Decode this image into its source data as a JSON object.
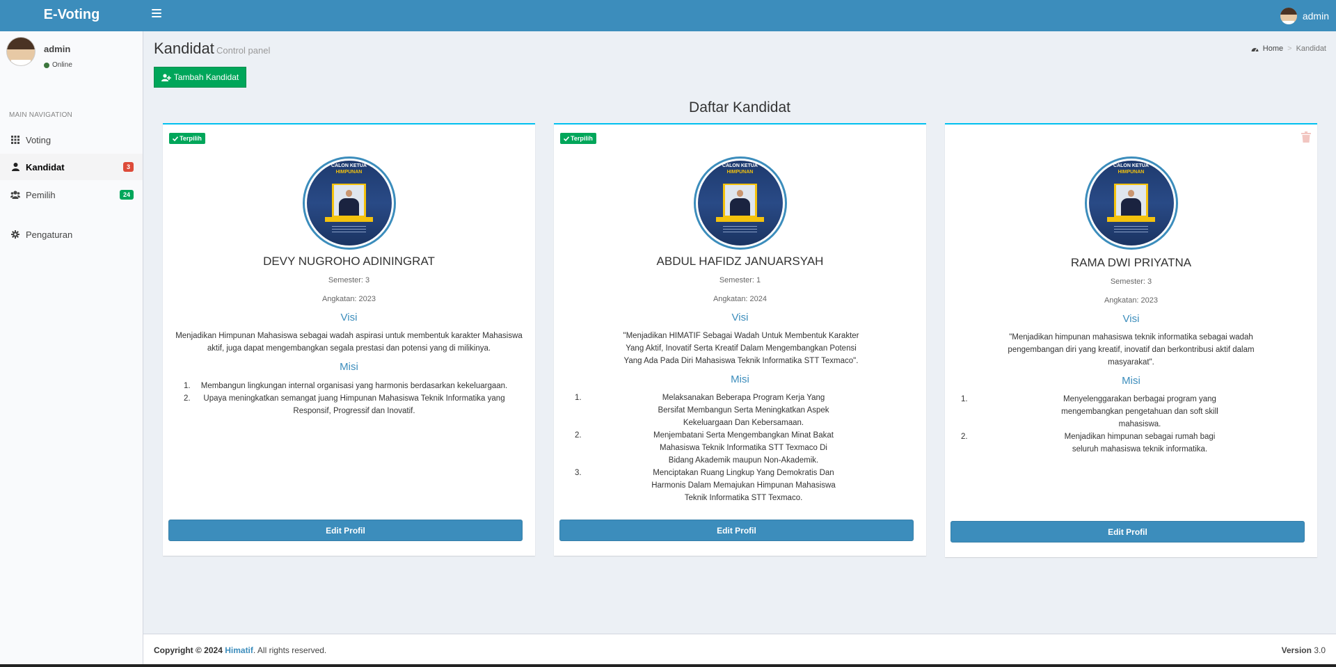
{
  "app": {
    "title": "E-Voting",
    "user": "admin"
  },
  "sidebar": {
    "user_name": "admin",
    "status": "Online",
    "header": "MAIN NAVIGATION",
    "items": [
      {
        "label": "Voting",
        "icon": "grid-icon"
      },
      {
        "label": "Kandidat",
        "icon": "user-icon",
        "badge": "3",
        "badge_color": "#dd4b39",
        "active": true
      },
      {
        "label": "Pemilih",
        "icon": "users-icon",
        "badge": "24",
        "badge_color": "#00a65a"
      },
      {
        "label": "Pengaturan",
        "icon": "gear-icon"
      }
    ]
  },
  "page": {
    "title": "Kandidat",
    "subtitle": "Control panel",
    "breadcrumb": [
      "Home",
      "Kandidat"
    ],
    "add_button": "Tambah Kandidat",
    "list_title": "Daftar Kandidat"
  },
  "photo_caption": {
    "line1": "CALON KETUA",
    "line2": "HIMPUNAN"
  },
  "candidates": [
    {
      "elected_label": "Terpilih",
      "name": "DEVY NUGROHO ADININGRAT",
      "semester": "Semester: 3",
      "angkatan": "Angkatan: 2023",
      "visi_title": "Visi",
      "visi": "Menjadikan Himpunan Mahasiswa sebagai wadah aspirasi untuk membentuk karakter Mahasiswa aktif, juga dapat mengembangkan segala prestasi dan potensi yang di milikinya.",
      "misi_title": "Misi",
      "misi": [
        "Membangun lingkungan internal organisasi yang harmonis berdasarkan kekeluargaan.",
        "Upaya meningkatkan semangat juang Himpunan Mahasiswa Teknik Informatika yang Responsif, Progressif dan Inovatif."
      ],
      "edit_button": "Edit Profil"
    },
    {
      "elected_label": "Terpilih",
      "name": "ABDUL HAFIDZ JANUARSYAH",
      "semester": "Semester: 1",
      "angkatan": "Angkatan: 2024",
      "visi_title": "Visi",
      "visi": "\"Menjadikan HIMATIF Sebagai Wadah Untuk Membentuk Karakter Yang Aktif, Inovatif Serta Kreatif Dalam Mengembangkan Potensi Yang Ada Pada Diri Mahasiswa Teknik Informatika STT Texmaco\".",
      "misi_title": "Misi",
      "misi": [
        "Melaksanakan Beberapa Program Kerja Yang Bersifat Membangun Serta Meningkatkan Aspek Kekeluargaan Dan Kebersamaan.",
        "Menjembatani Serta Mengembangkan Minat Bakat Mahasiswa Teknik Informatika STT Texmaco Di Bidang Akademik maupun Non-Akademik.",
        "Menciptakan Ruang Lingkup Yang Demokratis Dan Harmonis Dalam Memajukan Himpunan Mahasiswa Teknik Informatika STT Texmaco."
      ],
      "edit_button": "Edit Profil"
    },
    {
      "name": "RAMA DWI PRIYATNA",
      "semester": "Semester: 3",
      "angkatan": "Angkatan: 2023",
      "visi_title": "Visi",
      "visi": "\"Menjadikan himpunan mahasiswa teknik informatika sebagai wadah pengembangan diri yang kreatif, inovatif dan berkontribusi aktif dalam masyarakat\".",
      "misi_title": "Misi",
      "misi": [
        "Menyelenggarakan berbagai program yang mengembangkan pengetahuan dan soft skill mahasiswa.",
        "Menjadikan himpunan sebagai rumah bagi seluruh mahasiswa teknik informatika."
      ],
      "edit_button": "Edit Profil"
    }
  ],
  "footer": {
    "copyright_prefix": "Copyright © 2024",
    "brand": "Himatif",
    "suffix": ". All rights reserved.",
    "version_label": "Version",
    "version": "3.0"
  }
}
